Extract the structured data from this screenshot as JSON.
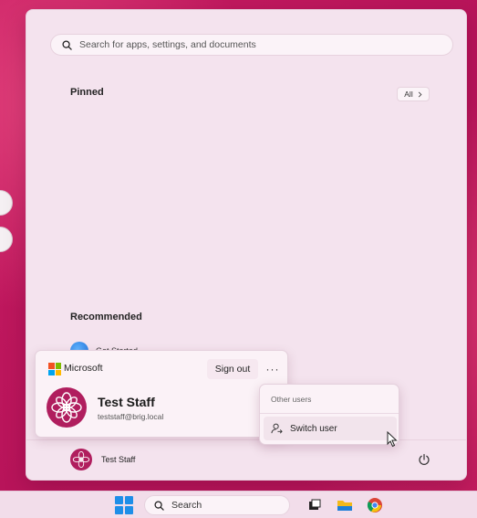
{
  "start_menu": {
    "search": {
      "placeholder": "Search for apps, settings, and documents"
    },
    "pinned": {
      "title": "Pinned",
      "all_label": "All"
    },
    "recommended": {
      "title": "Recommended",
      "items": [
        {
          "label": "Get Started"
        }
      ]
    },
    "account_card": {
      "brand": "Microsoft",
      "sign_out_label": "Sign out",
      "more_label": "···",
      "user_name": "Test Staff",
      "user_email": "teststaff@brig.local"
    },
    "other_users_popup": {
      "heading": "Other users",
      "switch_user_label": "Switch user"
    },
    "footer": {
      "user_name": "Test Staff"
    }
  },
  "taskbar": {
    "search_label": "Search",
    "icons": [
      "start-icon",
      "search-icon",
      "task-view-icon",
      "file-explorer-icon",
      "chrome-icon"
    ]
  },
  "colors": {
    "wallpaper": "#c2185b",
    "menu_bg": "#f4e3ee",
    "accent": "#1e8ee8",
    "avatar": "#b01e5e"
  },
  "icons": {
    "ms_logo": [
      "#f25022",
      "#7fba00",
      "#00a4ef",
      "#ffb900"
    ]
  }
}
